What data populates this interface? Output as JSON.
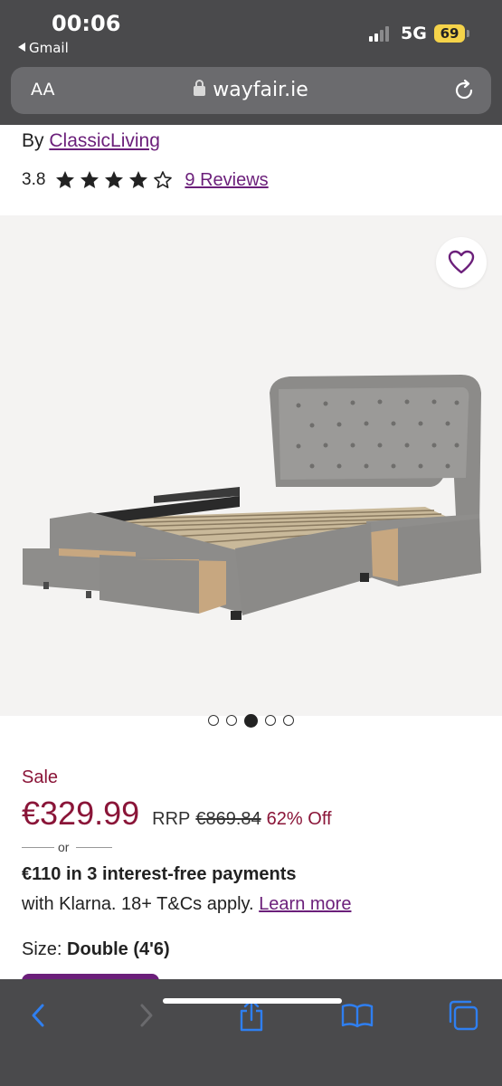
{
  "status_bar": {
    "time": "00:06",
    "back_app": "Gmail",
    "network": "5G",
    "battery": "69"
  },
  "browser": {
    "text_size_label": "AA",
    "url": "wayfair.ie"
  },
  "product": {
    "brand_prefix": "By",
    "brand_name": "ClassicLiving",
    "rating": "3.8",
    "stars_filled": 4,
    "stars_total": 5,
    "reviews_link": "9 Reviews",
    "image_count": 5,
    "active_image_index": 3,
    "sale_label": "Sale",
    "price": "€329.99",
    "rrp_label": "RRP",
    "rrp_value": "€869.84",
    "discount": "62% Off",
    "or_text": "or",
    "installments": "€110 in 3 interest-free payments",
    "klarna_text": "with Klarna. 18+ T&Cs apply.",
    "learn_more": "Learn more",
    "size_label": "Size:",
    "size_value": "Double (4'6)"
  },
  "colors": {
    "accent_purple": "#6b1f7a",
    "sale_red": "#8a1538",
    "ios_blue": "#2f7ff0"
  },
  "toolbar": {
    "icons": [
      "back-icon",
      "forward-icon",
      "share-icon",
      "bookmarks-icon",
      "tabs-icon"
    ]
  }
}
